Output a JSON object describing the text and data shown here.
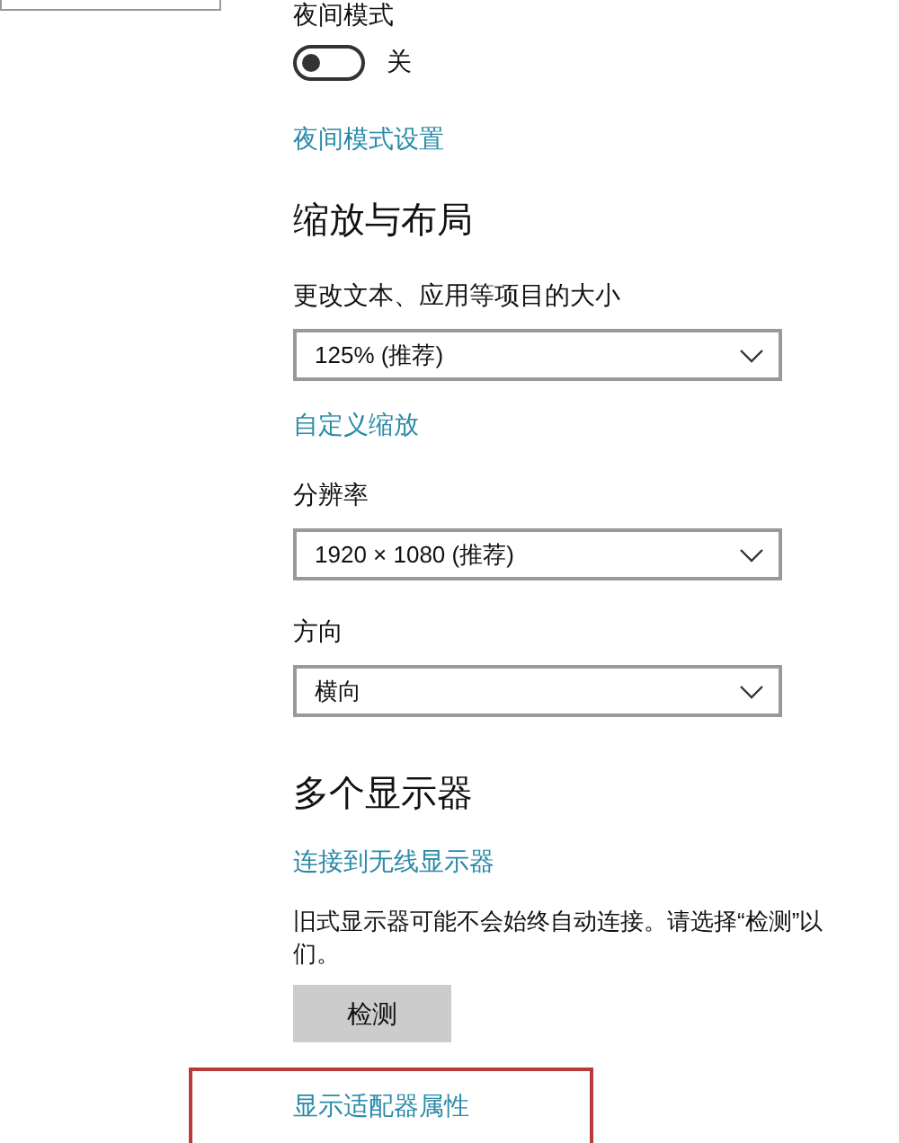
{
  "night_mode": {
    "label": "夜间模式",
    "toggle": {
      "on": false,
      "state_label": "关"
    },
    "settings_link": "夜间模式设置"
  },
  "scale_layout": {
    "heading": "缩放与布局",
    "dropdowns": [
      {
        "label": "更改文本、应用等项目的大小",
        "value": "125% (推荐)",
        "link": "自定义缩放"
      },
      {
        "label": "分辨率",
        "value": "1920 × 1080 (推荐)"
      },
      {
        "label": "方向",
        "value": "横向"
      }
    ]
  },
  "multiple_displays": {
    "heading": "多个显示器",
    "wireless_link": "连接到无线显示器",
    "description_lines": [
      "旧式显示器可能不会始终自动连接。请选择“检测”以",
      "们。"
    ],
    "detect_button": "检测"
  },
  "adapter_link": {
    "label": "显示适配器属性",
    "highlighted": true
  }
}
